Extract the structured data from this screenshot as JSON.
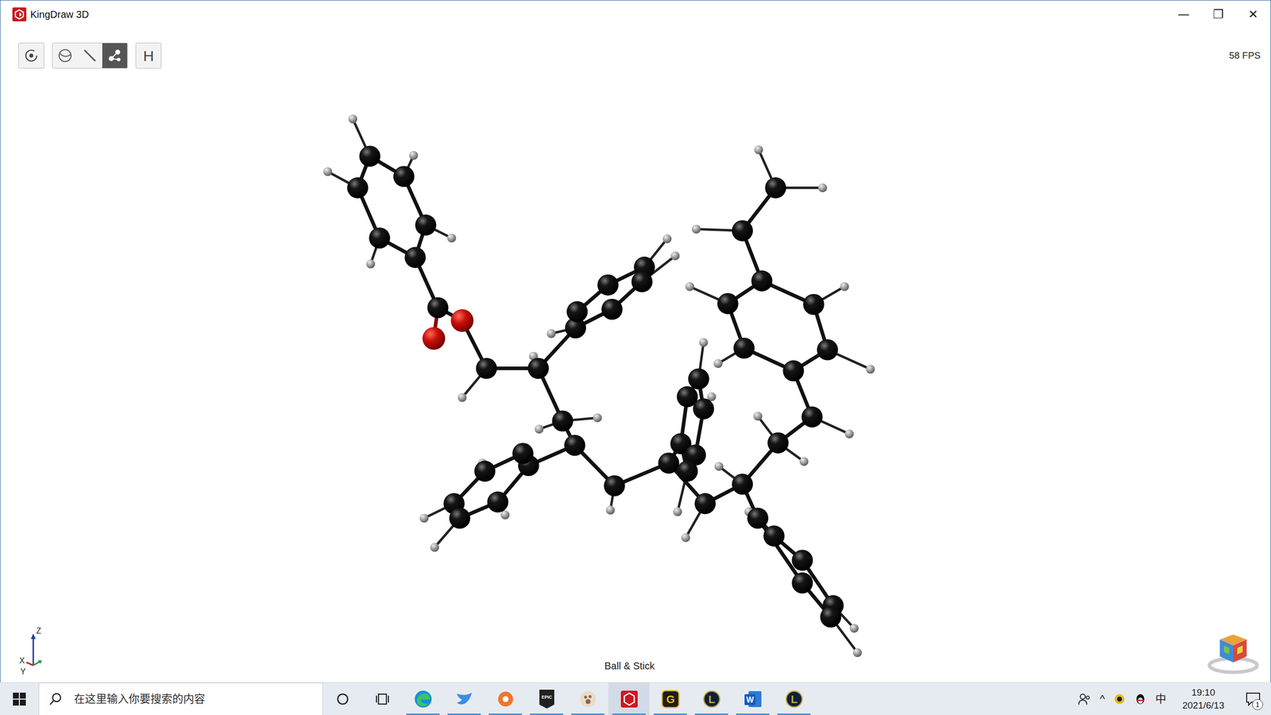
{
  "window": {
    "title": "KingDraw 3D",
    "controls": [
      "—",
      "❐",
      "✕"
    ]
  },
  "viewer": {
    "fps": "58 FPS",
    "mode_label": "Ball & Stick",
    "axes": [
      "Z",
      "X",
      "Y"
    ]
  },
  "toolbar": {
    "rotate": {
      "selected": false
    },
    "render_modes": [
      {
        "kind": "sphere",
        "selected": false
      },
      {
        "kind": "stick",
        "selected": false
      },
      {
        "kind": "ballstick",
        "selected": true
      }
    ],
    "hydrogen": {
      "label": "H",
      "selected": false
    }
  },
  "taskbar": {
    "search": {
      "placeholder": "在这里输入你要搜索的内容"
    },
    "apps": [
      {
        "kind": "edge",
        "glyph": "",
        "running": true,
        "selected": false
      },
      {
        "kind": "bird",
        "glyph": "",
        "running": true,
        "selected": false
      },
      {
        "kind": "orange",
        "glyph": "",
        "running": true,
        "selected": false
      },
      {
        "kind": "epic",
        "glyph": "EPIC",
        "running": true,
        "selected": false
      },
      {
        "kind": "paw",
        "glyph": "",
        "running": true,
        "selected": false
      },
      {
        "kind": "kingdraw",
        "glyph": "",
        "running": true,
        "selected": true
      },
      {
        "kind": "gbox",
        "glyph": "G",
        "running": true,
        "selected": false
      },
      {
        "kind": "league",
        "glyph": "L",
        "running": true,
        "selected": false
      },
      {
        "kind": "word",
        "glyph": "W",
        "running": true,
        "selected": false
      },
      {
        "kind": "league",
        "glyph": "L",
        "running": true,
        "selected": false
      }
    ],
    "tray": {
      "chevron": "^",
      "ime": "中",
      "time": "19:10",
      "date": "2021/6/13",
      "notifications": "1"
    }
  }
}
